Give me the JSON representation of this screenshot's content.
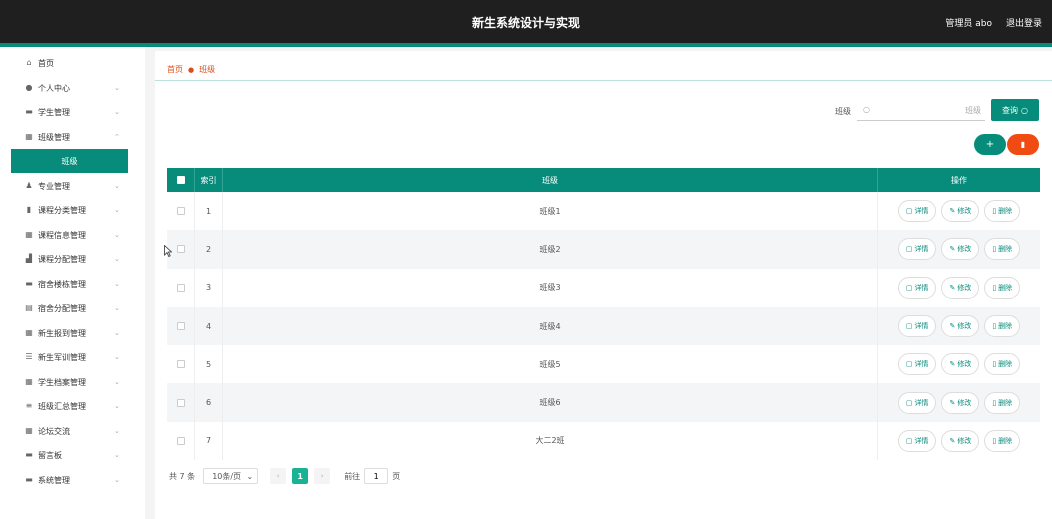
{
  "header": {
    "title": "新生系统设计与实现",
    "user": "管理员 abo",
    "logout": "退出登录"
  },
  "sidebar": {
    "items": [
      {
        "label": "首页",
        "icon": "home-icon",
        "chevron": false
      },
      {
        "label": "个人中心",
        "icon": "user-icon",
        "chevron": true
      },
      {
        "label": "学生管理",
        "icon": "chat-icon",
        "chevron": true
      },
      {
        "label": "班级管理",
        "icon": "grid-icon",
        "chevron": true
      },
      {
        "label": "专业管理",
        "icon": "person-icon",
        "chevron": true
      },
      {
        "label": "课程分类管理",
        "icon": "doc-icon",
        "chevron": true
      },
      {
        "label": "课程信息管理",
        "icon": "grid-icon",
        "chevron": true
      },
      {
        "label": "课程分配管理",
        "icon": "bar-chart-icon",
        "chevron": true
      },
      {
        "label": "宿舍楼栋管理",
        "icon": "chat-icon",
        "chevron": true
      },
      {
        "label": "宿舍分配管理",
        "icon": "calendar-icon",
        "chevron": true
      },
      {
        "label": "新生报到管理",
        "icon": "grid-icon",
        "chevron": true
      },
      {
        "label": "新生军训管理",
        "icon": "sliders-icon",
        "chevron": true
      },
      {
        "label": "学生档案管理",
        "icon": "grid-icon",
        "chevron": true
      },
      {
        "label": "班级汇总管理",
        "icon": "stack-icon",
        "chevron": true
      },
      {
        "label": "论坛交流",
        "icon": "grid-icon",
        "chevron": true
      },
      {
        "label": "留言板",
        "icon": "chat-icon",
        "chevron": true
      },
      {
        "label": "系统管理",
        "icon": "chat-icon",
        "chevron": true
      }
    ],
    "active_sub": "班级"
  },
  "breadcrumb": {
    "home": "首页",
    "current": "班级"
  },
  "search": {
    "label": "班级",
    "placeholder": "班级",
    "button": "查询"
  },
  "table": {
    "headers": {
      "index": "索引",
      "name": "班级",
      "ops": "操作"
    },
    "rows": [
      {
        "index": "1",
        "name": "班级1"
      },
      {
        "index": "2",
        "name": "班级2"
      },
      {
        "index": "3",
        "name": "班级3"
      },
      {
        "index": "4",
        "name": "班级4"
      },
      {
        "index": "5",
        "name": "班级5"
      },
      {
        "index": "6",
        "name": "班级6"
      },
      {
        "index": "7",
        "name": "大二2班"
      }
    ],
    "ops": {
      "detail": "详情",
      "edit": "修改",
      "delete": "删除"
    }
  },
  "pagination": {
    "total": "共 7 条",
    "page_size": "10条/页",
    "current": "1",
    "goto_label": "前往",
    "goto_value": "1",
    "page_unit": "页"
  },
  "colors": {
    "accent": "#078c7c",
    "danger": "#f04b12",
    "header_bg": "#1f1f1f"
  }
}
